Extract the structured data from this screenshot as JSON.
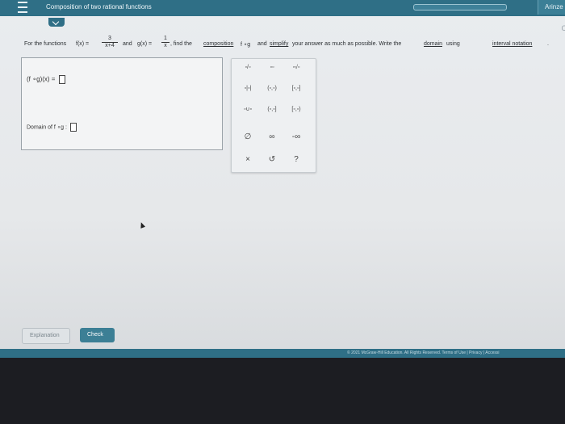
{
  "header": {
    "topic": "Composition of two rational functions",
    "aria_label": "Arinze"
  },
  "question": {
    "lead": "For the functions",
    "f_label": "f(x) =",
    "f_num": "3",
    "f_den": "x+4",
    "and": "and",
    "g_label": "g(x) =",
    "g_num": "1",
    "g_den": "x",
    "mid": ", find the",
    "link_composition": "composition",
    "fog": "f ∘g",
    "and2": "and",
    "link_simplify": "simplify",
    "rest": "your answer as much as possible. Write the",
    "link_domain": "domain",
    "using": "using",
    "link_interval": "interval notation",
    "end": "."
  },
  "answer": {
    "expr_label": "(f ∘g)(x) =",
    "domain_label": "Domain of f ∘g :"
  },
  "palette": {
    "keys": [
      {
        "name": "fraction-key",
        "glyph": "▫/▫"
      },
      {
        "name": "exponent-key",
        "glyph": "▫▫"
      },
      {
        "name": "radical-key",
        "glyph": "▫√▫"
      },
      {
        "name": "abs-key",
        "glyph": "▫|▫|"
      },
      {
        "name": "open-open-interval-key",
        "glyph": "(▫,▫)"
      },
      {
        "name": "closed-closed-interval-key",
        "glyph": "[▫,▫]"
      },
      {
        "name": "union-key",
        "glyph": "▫∪▫"
      },
      {
        "name": "open-closed-interval-key",
        "glyph": "(▫,▫]"
      },
      {
        "name": "closed-open-interval-key",
        "glyph": "[▫,▫)"
      },
      {
        "name": "empty-set-key",
        "glyph": "∅"
      },
      {
        "name": "infinity-key",
        "glyph": "∞"
      },
      {
        "name": "neg-infinity-key",
        "glyph": "-∞"
      },
      {
        "name": "clear-key",
        "glyph": "×"
      },
      {
        "name": "undo-key",
        "glyph": "↺"
      },
      {
        "name": "help-key",
        "glyph": "?"
      }
    ]
  },
  "buttons": {
    "explanation": "Explanation",
    "check": "Check"
  },
  "footer": {
    "copyright": "© 2021 McGraw-Hill Education. All Rights Reserved.   Terms of Use  |  Privacy  |  Accessi"
  }
}
